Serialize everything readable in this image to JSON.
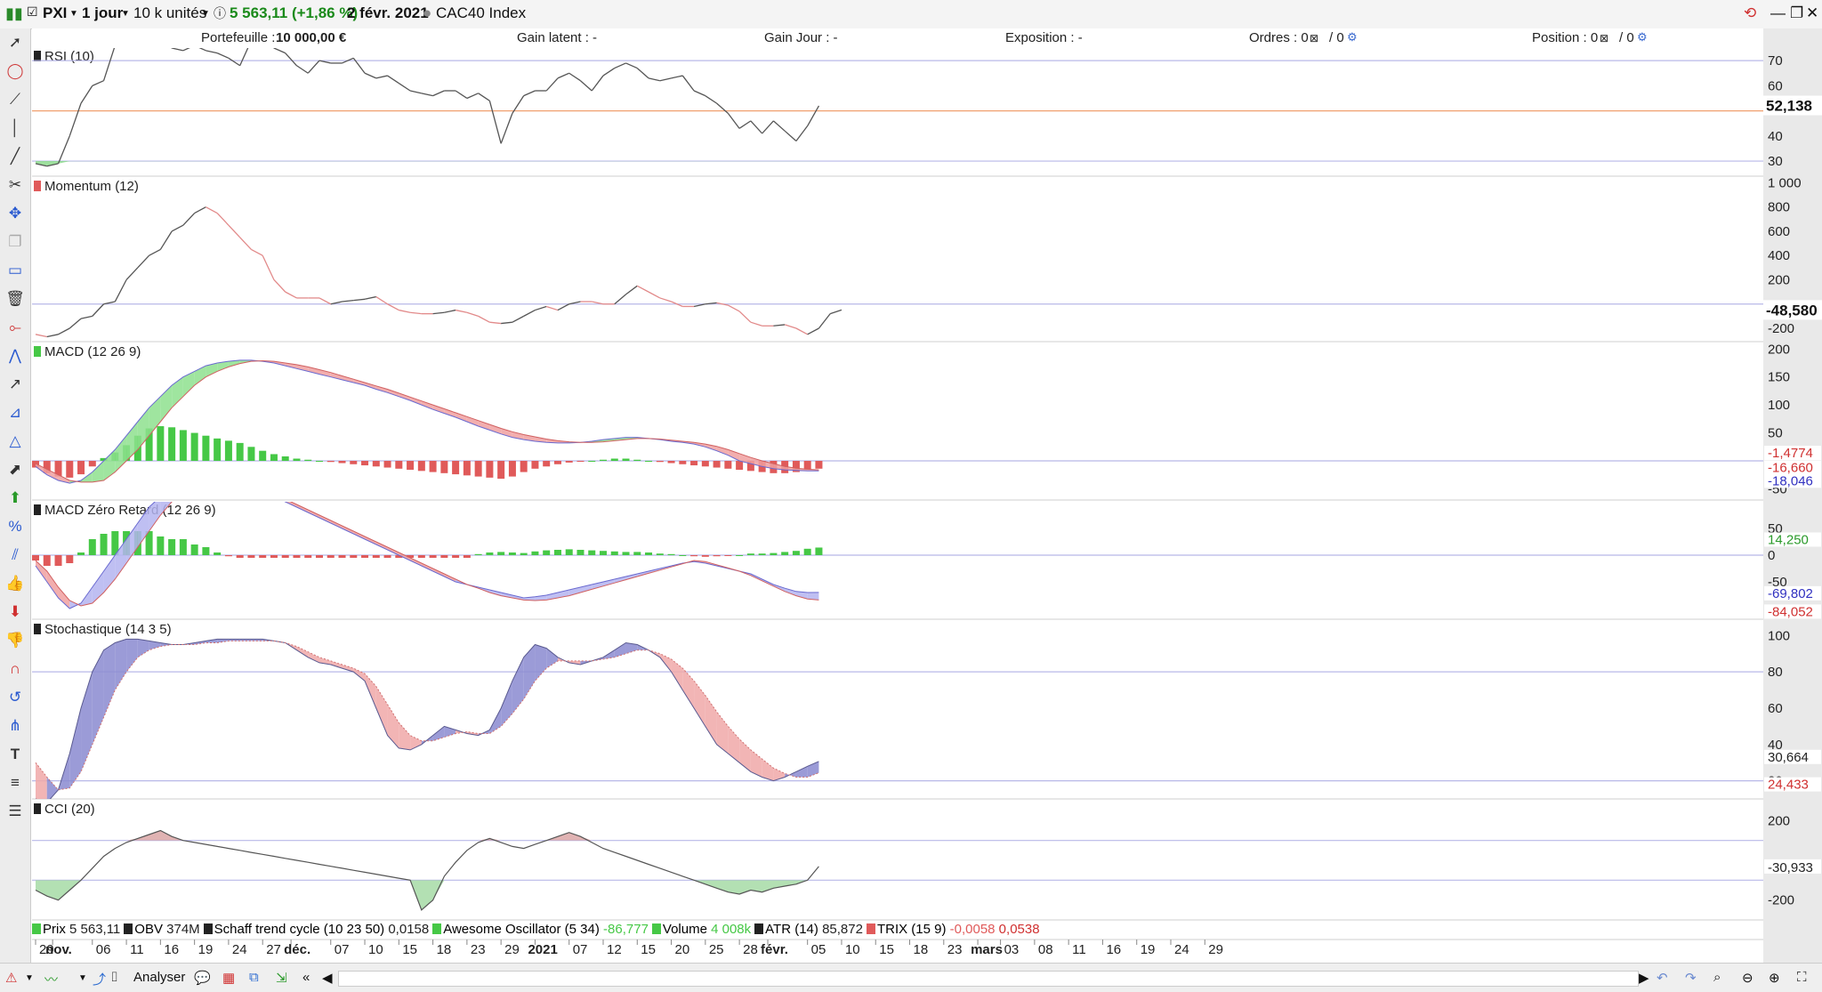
{
  "toolbar": {
    "symbol": "PXI",
    "period": "1 jour",
    "units": "10 k unités",
    "price": "5 563,11 (+1,86 %)",
    "date": "2 févr. 2021",
    "index": "CAC40 Index"
  },
  "info": {
    "portefeuille_label": "Portefeuille :",
    "portefeuille_value": "10 000,00 €",
    "gain_latent": "Gain latent : -",
    "gain_jour": "Gain Jour : -",
    "exposition": "Exposition : -",
    "ordres": "Ordres : 0",
    "ordres_b": "/ 0",
    "position": "Position : 0",
    "position_b": "/ 0"
  },
  "colors": {
    "up": "#46c846",
    "down": "#e05a5a",
    "line_blue": "#6a6ad0",
    "grid": "#b8b8e8",
    "ref_orange": "#f0a070"
  },
  "chart_data": [
    {
      "type": "line",
      "title": "RSI (10)",
      "ylim": [
        24,
        75
      ],
      "ticks": [
        "70",
        "60",
        "40",
        "30"
      ],
      "tick_values": [
        70,
        60,
        40,
        30
      ],
      "current": "52,138",
      "current_value": 52.138,
      "reference": 50,
      "bands": [
        70,
        30
      ],
      "values": [
        29,
        28,
        29,
        40,
        53,
        60,
        62,
        76,
        80,
        83,
        82,
        79,
        75,
        74,
        76,
        74,
        73,
        71,
        68,
        78,
        79,
        75,
        73,
        68,
        65,
        70,
        69,
        69,
        71,
        65,
        63,
        64,
        61,
        58,
        57,
        56,
        58,
        58,
        55,
        57,
        54,
        37,
        49,
        56,
        58,
        58,
        63,
        65,
        62,
        58,
        64,
        67,
        69,
        67,
        63,
        62,
        63,
        64,
        58,
        56,
        53,
        49,
        43,
        46,
        41,
        46,
        42,
        38,
        44,
        52
      ]
    },
    {
      "type": "line",
      "title": "Momentum (12)",
      "ylim": [
        -310,
        1040
      ],
      "ticks": [
        "1 000",
        "800",
        "600",
        "400",
        "200",
        "-200"
      ],
      "tick_values": [
        1000,
        800,
        600,
        400,
        200,
        -200
      ],
      "current": "-48,580",
      "current_value": -48.58,
      "reference": 0,
      "values": [
        -250,
        -270,
        -250,
        -200,
        -120,
        -100,
        0,
        20,
        200,
        300,
        400,
        450,
        600,
        650,
        750,
        800,
        750,
        650,
        550,
        450,
        400,
        200,
        100,
        50,
        50,
        50,
        0,
        20,
        30,
        40,
        60,
        0,
        -50,
        -70,
        -80,
        -80,
        -70,
        -50,
        -70,
        -100,
        -150,
        -160,
        -150,
        -100,
        -50,
        -20,
        -50,
        0,
        20,
        20,
        0,
        0,
        80,
        150,
        100,
        50,
        20,
        -20,
        -20,
        0,
        10,
        -10,
        -60,
        -150,
        -180,
        -180,
        -170,
        -200,
        -250,
        -200,
        -80,
        -48.58
      ]
    },
    {
      "type": "bar",
      "title": "MACD (12 26 9)",
      "ylim": [
        -70,
        210
      ],
      "ticks": [
        "200",
        "150",
        "100",
        "50",
        "-50"
      ],
      "tick_values": [
        200,
        150,
        100,
        50,
        -50
      ],
      "labels": [
        "-1,4774",
        "-16,660",
        "-18,046"
      ],
      "macd": [
        -10,
        -25,
        -35,
        -40,
        -35,
        -20,
        0,
        20,
        45,
        70,
        95,
        115,
        135,
        150,
        160,
        170,
        175,
        178,
        180,
        180,
        178,
        175,
        170,
        165,
        160,
        155,
        150,
        145,
        140,
        135,
        128,
        122,
        115,
        108,
        100,
        92,
        85,
        78,
        70,
        62,
        55,
        48,
        42,
        38,
        35,
        33,
        32,
        32,
        33,
        35,
        38,
        40,
        42,
        42,
        40,
        38,
        35,
        33,
        30,
        25,
        18,
        10,
        0,
        -5,
        -10,
        -14,
        -16,
        -17,
        -18,
        -18
      ],
      "signal": [
        -5,
        -15,
        -25,
        -35,
        -38,
        -38,
        -35,
        -20,
        0,
        20,
        45,
        70,
        95,
        115,
        135,
        150,
        160,
        168,
        174,
        178,
        179,
        178,
        175,
        172,
        168,
        163,
        158,
        152,
        146,
        140,
        134,
        128,
        121,
        114,
        107,
        100,
        93,
        86,
        79,
        72,
        65,
        58,
        52,
        47,
        43,
        39,
        36,
        34,
        33,
        33,
        34,
        36,
        38,
        40,
        40,
        39,
        37,
        35,
        33,
        30,
        26,
        20,
        13,
        6,
        0,
        -5,
        -10,
        -13,
        -15,
        -16
      ],
      "histogram": [
        -12,
        -22,
        -28,
        -30,
        -24,
        -10,
        5,
        15,
        28,
        45,
        58,
        62,
        60,
        55,
        50,
        45,
        40,
        36,
        32,
        25,
        18,
        12,
        8,
        4,
        2,
        0,
        -2,
        -4,
        -6,
        -8,
        -10,
        -12,
        -14,
        -16,
        -18,
        -20,
        -22,
        -24,
        -26,
        -28,
        -30,
        -32,
        -28,
        -20,
        -14,
        -10,
        -6,
        -3,
        -1,
        0,
        2,
        4,
        4,
        2,
        0,
        -2,
        -4,
        -6,
        -8,
        -10,
        -12,
        -14,
        -16,
        -18,
        -20,
        -22,
        -22,
        -20,
        -16,
        -14
      ]
    },
    {
      "type": "bar",
      "title": "MACD Zéro Retard (12 26 9)",
      "ylim": [
        -120,
        100
      ],
      "ticks": [
        "50",
        "0",
        "-50"
      ],
      "tick_values": [
        50,
        0,
        -50
      ],
      "labels": [
        "14,250",
        "-69,802",
        "-84,052"
      ],
      "macd": [
        -20,
        -50,
        -80,
        -100,
        -90,
        -60,
        -30,
        0,
        30,
        60,
        90,
        110,
        130,
        150,
        160,
        165,
        160,
        150,
        140,
        130,
        120,
        110,
        100,
        90,
        80,
        70,
        60,
        50,
        40,
        30,
        20,
        10,
        0,
        -10,
        -20,
        -30,
        -40,
        -50,
        -55,
        -60,
        -65,
        -70,
        -75,
        -80,
        -78,
        -75,
        -70,
        -65,
        -60,
        -55,
        -50,
        -45,
        -40,
        -35,
        -30,
        -25,
        -20,
        -15,
        -12,
        -15,
        -20,
        -25,
        -30,
        -35,
        -45,
        -55,
        -62,
        -68,
        -70,
        -69.8
      ],
      "signal": [
        -10,
        -30,
        -60,
        -85,
        -95,
        -90,
        -70,
        -45,
        -15,
        15,
        45,
        75,
        100,
        120,
        140,
        150,
        155,
        152,
        145,
        135,
        125,
        115,
        105,
        95,
        85,
        75,
        65,
        55,
        45,
        35,
        25,
        15,
        5,
        -5,
        -15,
        -25,
        -35,
        -45,
        -55,
        -62,
        -70,
        -76,
        -80,
        -84,
        -85,
        -84,
        -80,
        -76,
        -70,
        -64,
        -58,
        -52,
        -46,
        -40,
        -34,
        -28,
        -22,
        -16,
        -10,
        -12,
        -18,
        -24,
        -30,
        -38,
        -48,
        -58,
        -68,
        -76,
        -82,
        -84
      ],
      "histogram": [
        -10,
        -20,
        -20,
        -15,
        5,
        30,
        40,
        45,
        45,
        45,
        45,
        35,
        30,
        30,
        20,
        15,
        5,
        -2,
        -5,
        -5,
        -5,
        -5,
        -5,
        -5,
        -5,
        -5,
        -5,
        -5,
        -5,
        -5,
        -5,
        -5,
        -5,
        -5,
        -5,
        -5,
        -5,
        -5,
        -5,
        2,
        5,
        6,
        5,
        4,
        7,
        9,
        10,
        11,
        10,
        9,
        8,
        7,
        6,
        6,
        5,
        3,
        2,
        0,
        -2,
        -3,
        -2,
        -1,
        0,
        3,
        3,
        4,
        6,
        8,
        12,
        14.25
      ]
    },
    {
      "type": "line",
      "title": "Stochastique (14 3 5)",
      "ylim": [
        10,
        108
      ],
      "ticks": [
        "100",
        "80",
        "60",
        "40",
        "20"
      ],
      "tick_values": [
        100,
        80,
        60,
        40,
        20
      ],
      "labels": [
        "30,664",
        "24,433"
      ],
      "bands": [
        80,
        20
      ],
      "k": [
        10,
        8,
        15,
        35,
        60,
        80,
        92,
        96,
        98,
        98,
        97,
        96,
        95,
        95,
        96,
        97,
        98,
        98,
        98,
        98,
        98,
        97,
        96,
        92,
        88,
        85,
        84,
        82,
        80,
        75,
        60,
        45,
        38,
        37,
        40,
        45,
        50,
        48,
        46,
        45,
        48,
        60,
        75,
        88,
        95,
        93,
        88,
        85,
        84,
        86,
        88,
        92,
        96,
        95,
        92,
        88,
        80,
        70,
        60,
        50,
        40,
        35,
        30,
        25,
        22,
        20,
        22,
        25,
        28,
        30.7
      ],
      "d": [
        30,
        22,
        15,
        16,
        25,
        40,
        55,
        70,
        80,
        88,
        92,
        94,
        95,
        95,
        95,
        96,
        96,
        97,
        97,
        97,
        97,
        97,
        96,
        94,
        91,
        88,
        86,
        84,
        82,
        79,
        72,
        62,
        52,
        45,
        42,
        42,
        44,
        46,
        47,
        46,
        46,
        50,
        57,
        65,
        75,
        82,
        86,
        86,
        86,
        86,
        87,
        88,
        90,
        92,
        92,
        90,
        87,
        82,
        75,
        67,
        58,
        50,
        43,
        37,
        32,
        27,
        24,
        22,
        22,
        24.4
      ]
    },
    {
      "type": "area",
      "title": "CCI (20)",
      "ylim": [
        -300,
        300
      ],
      "ticks": [
        "200",
        "-200"
      ],
      "tick_values": [
        200,
        -200
      ],
      "current": "-30,933",
      "current_value": -30.933,
      "bands": [
        100,
        -100
      ],
      "values": [
        -150,
        -180,
        -200,
        -150,
        -100,
        -40,
        20,
        60,
        90,
        110,
        130,
        150,
        120,
        100,
        90,
        80,
        70,
        60,
        50,
        40,
        30,
        20,
        10,
        0,
        -10,
        -20,
        -30,
        -40,
        -50,
        -60,
        -70,
        -80,
        -90,
        -100,
        -250,
        -200,
        -80,
        -10,
        50,
        90,
        110,
        90,
        70,
        60,
        80,
        100,
        120,
        140,
        120,
        90,
        60,
        40,
        20,
        0,
        -20,
        -40,
        -60,
        -80,
        -100,
        -120,
        -140,
        -160,
        -170,
        -150,
        -160,
        -140,
        -130,
        -120,
        -100,
        -30.9
      ]
    }
  ],
  "x_axis": {
    "ticks": [
      {
        "label": "29",
        "i": 0,
        "bold": false
      },
      {
        "label": "nov.",
        "i": 1.5,
        "bold": true
      },
      {
        "label": "06",
        "i": 5,
        "bold": false
      },
      {
        "label": "11",
        "i": 8,
        "bold": false
      },
      {
        "label": "16",
        "i": 11,
        "bold": false
      },
      {
        "label": "19",
        "i": 14,
        "bold": false
      },
      {
        "label": "24",
        "i": 17,
        "bold": false
      },
      {
        "label": "27",
        "i": 20,
        "bold": false
      },
      {
        "label": "déc.",
        "i": 22.5,
        "bold": true
      },
      {
        "label": "07",
        "i": 26,
        "bold": false
      },
      {
        "label": "10",
        "i": 29,
        "bold": false
      },
      {
        "label": "15",
        "i": 32,
        "bold": false
      },
      {
        "label": "18",
        "i": 35,
        "bold": false
      },
      {
        "label": "23",
        "i": 38,
        "bold": false
      },
      {
        "label": "29",
        "i": 41,
        "bold": false
      },
      {
        "label": "2021",
        "i": 44,
        "bold": true
      },
      {
        "label": "07",
        "i": 47,
        "bold": false
      },
      {
        "label": "12",
        "i": 50,
        "bold": false
      },
      {
        "label": "15",
        "i": 53,
        "bold": false
      },
      {
        "label": "20",
        "i": 56,
        "bold": false
      },
      {
        "label": "25",
        "i": 59,
        "bold": false
      },
      {
        "label": "28",
        "i": 62,
        "bold": false
      },
      {
        "label": "févr.",
        "i": 64.5,
        "bold": true
      },
      {
        "label": "05",
        "i": 68,
        "bold": false
      },
      {
        "label": "10",
        "i": 71,
        "bold": false
      },
      {
        "label": "15",
        "i": 74,
        "bold": false
      },
      {
        "label": "18",
        "i": 77,
        "bold": false
      },
      {
        "label": "23",
        "i": 80,
        "bold": false
      },
      {
        "label": "mars",
        "i": 83,
        "bold": true
      },
      {
        "label": "03",
        "i": 85,
        "bold": false
      },
      {
        "label": "08",
        "i": 88,
        "bold": false
      },
      {
        "label": "11",
        "i": 91,
        "bold": false
      },
      {
        "label": "16",
        "i": 94,
        "bold": false
      },
      {
        "label": "19",
        "i": 97,
        "bold": false
      },
      {
        "label": "24",
        "i": 100,
        "bold": false
      },
      {
        "label": "29",
        "i": 103,
        "bold": false
      }
    ]
  },
  "legend_items": [
    {
      "name": "Prix",
      "value": "5 563,11",
      "color": "#46c846"
    },
    {
      "name": "OBV",
      "value": "374M",
      "color": "#222222"
    },
    {
      "name": "Schaff trend cycle (10 23 50)",
      "value": "0,0158",
      "color": "#222222"
    },
    {
      "name": "Awesome Oscillator (5 34)",
      "value": "-86,777",
      "color": "#46c846"
    },
    {
      "name": "Volume",
      "value": "4 008k",
      "color": "#46c846"
    },
    {
      "name": "ATR (14)",
      "value": "85,872",
      "color": "#222222"
    },
    {
      "name": "TRIX (15 9)",
      "value": "-0,0058",
      "value2": "0,0538",
      "color": "#e05a5a"
    }
  ],
  "bottom": {
    "analyser": "Analyser"
  }
}
